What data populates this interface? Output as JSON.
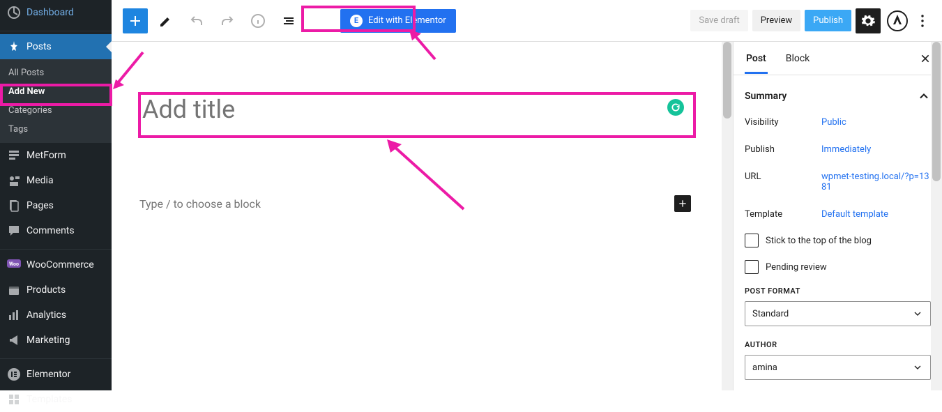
{
  "sidebar": {
    "dashboard": "Dashboard",
    "posts": "Posts",
    "posts_sub": {
      "all": "All Posts",
      "add_new": "Add New",
      "categories": "Categories",
      "tags": "Tags"
    },
    "metform": "MetForm",
    "media": "Media",
    "pages": "Pages",
    "comments": "Comments",
    "woocommerce": "WooCommerce",
    "products": "Products",
    "analytics": "Analytics",
    "marketing": "Marketing",
    "elementor": "Elementor",
    "templates": "Templates"
  },
  "toolbar": {
    "elementor_btn": "Edit with Elementor",
    "save_draft": "Save draft",
    "preview": "Preview",
    "publish": "Publish"
  },
  "editor": {
    "title_placeholder": "Add title",
    "slash_prompt": "Type / to choose a block"
  },
  "settings": {
    "tabs": {
      "post": "Post",
      "block": "Block"
    },
    "summary": {
      "heading": "Summary",
      "visibility_k": "Visibility",
      "visibility_v": "Public",
      "publish_k": "Publish",
      "publish_v": "Immediately",
      "url_k": "URL",
      "url_v": "wpmet-testing.local/?p=1381",
      "template_k": "Template",
      "template_v": "Default template",
      "stick": "Stick to the top of the blog",
      "pending": "Pending review"
    },
    "post_format": {
      "label": "POST FORMAT",
      "value": "Standard"
    },
    "author": {
      "label": "AUTHOR",
      "value": "amina"
    }
  }
}
